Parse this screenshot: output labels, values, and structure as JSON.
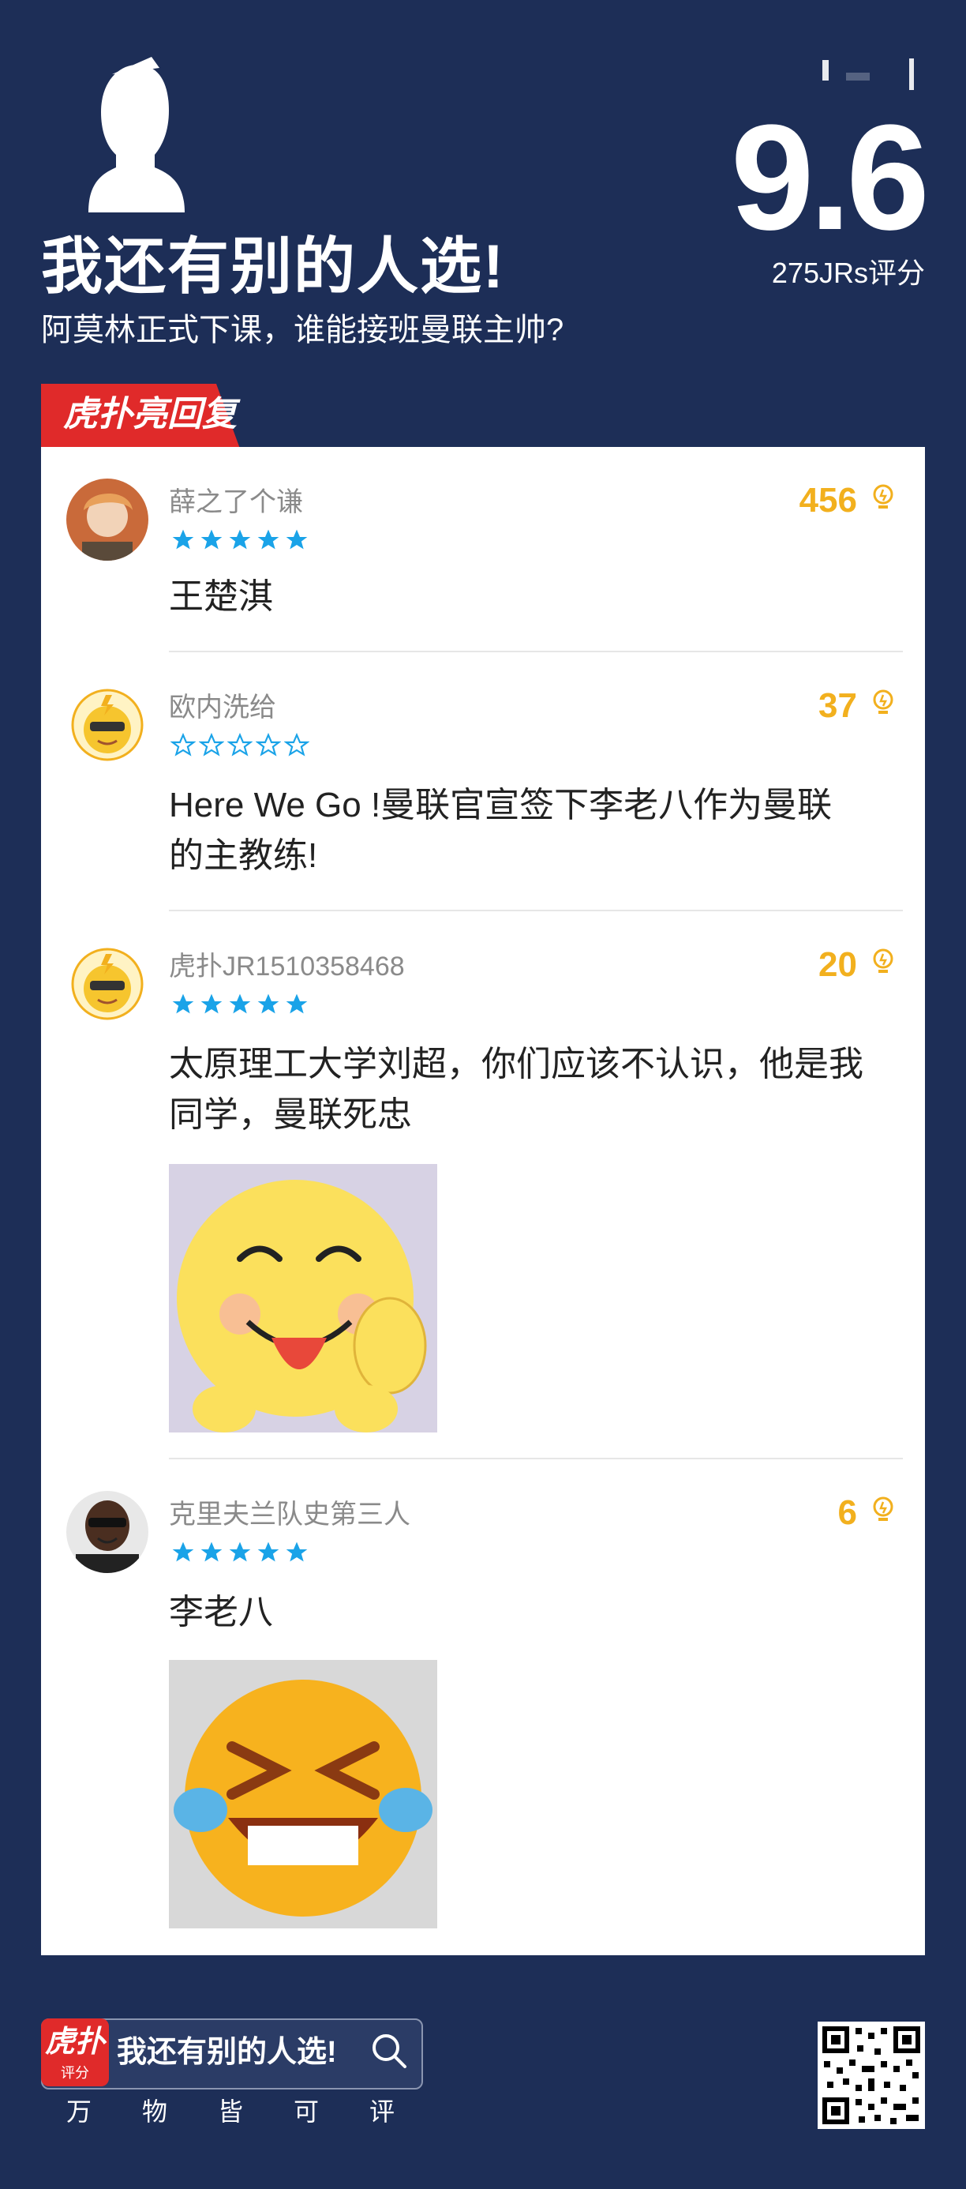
{
  "header": {
    "title": "我还有别的人选!",
    "subtitle": "阿莫林正式下课，谁能接班曼联主帅?",
    "score": "9.6",
    "rating_count": "275JRs评分"
  },
  "banner": {
    "label": "虎扑亮回复"
  },
  "replies": [
    {
      "username": "薛之了个谦",
      "stars": 5,
      "likes": "456",
      "text": "王楚淇"
    },
    {
      "username": "欧内洗给",
      "stars": 0,
      "likes": "37",
      "text_line1": "Here We Go !曼联官宣签下李老八作为曼联",
      "text_line2": "的主教练!"
    },
    {
      "username": "虎扑JR1510358468",
      "stars": 5,
      "likes": "20",
      "text_line1": "太原理工大学刘超，你们应该不认识，他是我",
      "text_line2": "同学，曼联死忠"
    },
    {
      "username": "克里夫兰队史第三人",
      "stars": 5,
      "likes": "6",
      "text": "李老八"
    }
  ],
  "footer": {
    "logo_text": "虎扑",
    "logo_sub": "评分",
    "search_text": "我还有别的人选!",
    "slogan": [
      "万",
      "物",
      "皆",
      "可",
      "评"
    ]
  },
  "colors": {
    "background": "#1d2e57",
    "accent": "#e02a2a",
    "likes": "#f2b01e",
    "star": "#1aa3e8"
  }
}
